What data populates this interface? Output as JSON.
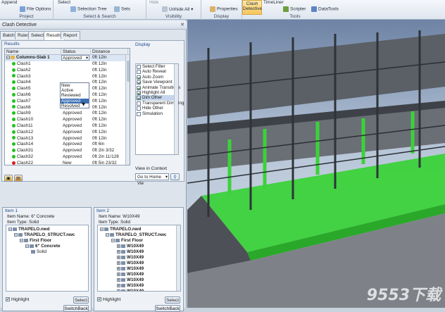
{
  "ribbon": {
    "append": "Append",
    "file_options": "File Options",
    "project_group": "Project",
    "select": "Select",
    "selection_tree": "Selection Tree",
    "sets": "Sets",
    "select_search_group": "Select & Search",
    "hide": "Hide",
    "unhide_all": "Unhide All",
    "visibility_group": "Visibility",
    "properties": "Properties",
    "display_group": "Display",
    "clash_detective": "Clash Detective",
    "timeliner": "TimeLiner",
    "scripter": "Scripter",
    "datatools": "DataTools",
    "tools_group": "Tools"
  },
  "panel": {
    "title": "Clash Detective",
    "tabs": [
      "Batch",
      "Rules",
      "Select",
      "Results",
      "Report"
    ],
    "results_label": "Results",
    "columns": [
      "Name",
      "Status",
      "Distance"
    ],
    "group_row": {
      "name": "Columns-Slab 1",
      "status": "Approved",
      "distance": "0ft 12in"
    },
    "rows": [
      {
        "name": "Clash1",
        "status": "",
        "distance": "0ft 12in",
        "color": "#22c21e"
      },
      {
        "name": "Clash2",
        "status": "",
        "distance": "0ft 12in",
        "color": "#22c21e"
      },
      {
        "name": "Clash3",
        "status": "",
        "distance": "0ft 12in",
        "color": "#22c21e"
      },
      {
        "name": "Clash4",
        "status": "",
        "distance": "0ft 12in",
        "color": "#22c21e"
      },
      {
        "name": "Clash5",
        "status": "Approved",
        "distance": "0ft 12in",
        "color": "#22c21e"
      },
      {
        "name": "Clash6",
        "status": "Approved",
        "distance": "0ft 12in",
        "color": "#22c21e"
      },
      {
        "name": "Clash7",
        "status": "Approved",
        "distance": "0ft 12in",
        "color": "#22c21e"
      },
      {
        "name": "Clash8",
        "status": "Approved",
        "distance": "0ft 12in",
        "color": "#22c21e"
      },
      {
        "name": "Clash9",
        "status": "Approved",
        "distance": "0ft 12in",
        "color": "#22c21e"
      },
      {
        "name": "Clash10",
        "status": "Approved",
        "distance": "0ft 12in",
        "color": "#22c21e"
      },
      {
        "name": "Clash11",
        "status": "Approved",
        "distance": "0ft 12in",
        "color": "#22c21e"
      },
      {
        "name": "Clash12",
        "status": "Approved",
        "distance": "0ft 12in",
        "color": "#22c21e"
      },
      {
        "name": "Clash13",
        "status": "Approved",
        "distance": "0ft 12in",
        "color": "#22c21e"
      },
      {
        "name": "Clash14",
        "status": "Approved",
        "distance": "0ft 6in",
        "color": "#22c21e"
      },
      {
        "name": "Clash31",
        "status": "Approved",
        "distance": "0ft 2in 3/32",
        "color": "#22c21e"
      },
      {
        "name": "Clash32",
        "status": "Approved",
        "distance": "0ft 2in 11/128",
        "color": "#22c21e"
      },
      {
        "name": "Clash22",
        "status": "New",
        "distance": "0ft 5in 23/32",
        "color": "#e01b1b"
      }
    ],
    "dropdown_options": [
      "New",
      "Active",
      "Reviewed",
      "Approved",
      "Resolved"
    ],
    "dropdown_selected": "Approved",
    "display_label": "Display",
    "display_options": [
      {
        "label": "Select Filter",
        "checked": false
      },
      {
        "label": "Auto Reveal",
        "checked": false
      },
      {
        "label": "Auto Zoom",
        "checked": true
      },
      {
        "label": "Save Viewpoint",
        "checked": true
      },
      {
        "label": "Animate Transitions",
        "checked": true
      },
      {
        "label": "Highlight All",
        "checked": true
      },
      {
        "label": "Dim Other",
        "checked": true
      },
      {
        "label": "Transparent Dimming",
        "checked": false
      },
      {
        "label": "Hide Other",
        "checked": false
      },
      {
        "label": "Simulation",
        "checked": false
      }
    ],
    "view_in_context_label": "View in Context",
    "view_in_context_value": "Go to Home Vie"
  },
  "item1": {
    "title": "Item 1",
    "name_line": "Item Name: 6\" Concrete",
    "type_line": "Item Type: Solid",
    "tree": [
      {
        "label": "TRAPELO.nwd",
        "level": 0
      },
      {
        "label": "TRAPELO_STRUCT.nwc",
        "level": 1
      },
      {
        "label": "First Floor",
        "level": 2
      },
      {
        "label": "6\" Concrete",
        "level": 3
      },
      {
        "label": "Solid",
        "level": 4
      }
    ],
    "highlight_label": "Highlight",
    "select_button": "Select",
    "switchback_button": "SwitchBack"
  },
  "item2": {
    "title": "Item 2",
    "name_line": "Item Name: W10X49",
    "type_line": "Item Type: Solid",
    "tree": [
      {
        "label": "TRAPELO.nwd",
        "level": 0
      },
      {
        "label": "TRAPELO_STRUCT.nwc",
        "level": 1
      },
      {
        "label": "First Floor",
        "level": 2
      },
      {
        "label": "W10X49",
        "level": 3
      },
      {
        "label": "W10X49",
        "level": 3
      },
      {
        "label": "W10X49",
        "level": 3
      },
      {
        "label": "W10X49",
        "level": 3
      },
      {
        "label": "W10X49",
        "level": 3
      },
      {
        "label": "W10X49",
        "level": 3
      },
      {
        "label": "W10X49",
        "level": 3
      },
      {
        "label": "W10X49",
        "level": 3
      },
      {
        "label": "W10X49",
        "level": 3
      },
      {
        "label": "W10X49",
        "level": 3
      },
      {
        "label": "W10X49",
        "level": 3
      }
    ],
    "highlight_label": "Highlight",
    "select_button": "Select",
    "switchback_button": "SwitchBack"
  },
  "watermark": "9553下载",
  "colors": {
    "clash_green": "#22c21e",
    "clash_red": "#e01b1b",
    "accent_blue": "#3a6fb4"
  }
}
